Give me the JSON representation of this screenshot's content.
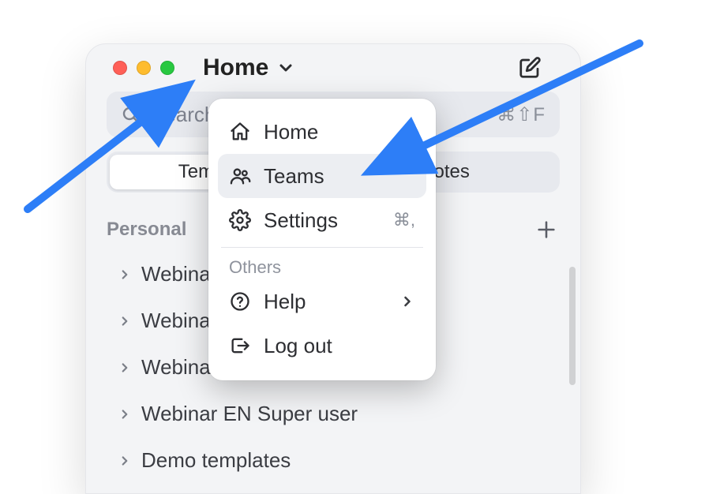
{
  "title": "Home",
  "search": {
    "placeholder": "Search",
    "shortcut": "⌘⇧F"
  },
  "tabs": {
    "left": "Templates",
    "right": "Notes",
    "active": "left"
  },
  "section": {
    "label": "Personal"
  },
  "tree": [
    {
      "label": "Webinar"
    },
    {
      "label": "Webinar"
    },
    {
      "label": "Webinar EN Getting started"
    },
    {
      "label": "Webinar EN Super user"
    },
    {
      "label": "Demo templates"
    }
  ],
  "menu": {
    "items": [
      {
        "icon": "home",
        "label": "Home",
        "shortcut": ""
      },
      {
        "icon": "teams",
        "label": "Teams",
        "shortcut": "",
        "hover": true
      },
      {
        "icon": "gear",
        "label": "Settings",
        "shortcut": "⌘,"
      }
    ],
    "others_label": "Others",
    "others": [
      {
        "icon": "help",
        "label": "Help",
        "arrow": true
      },
      {
        "icon": "logout",
        "label": "Log out"
      }
    ]
  }
}
